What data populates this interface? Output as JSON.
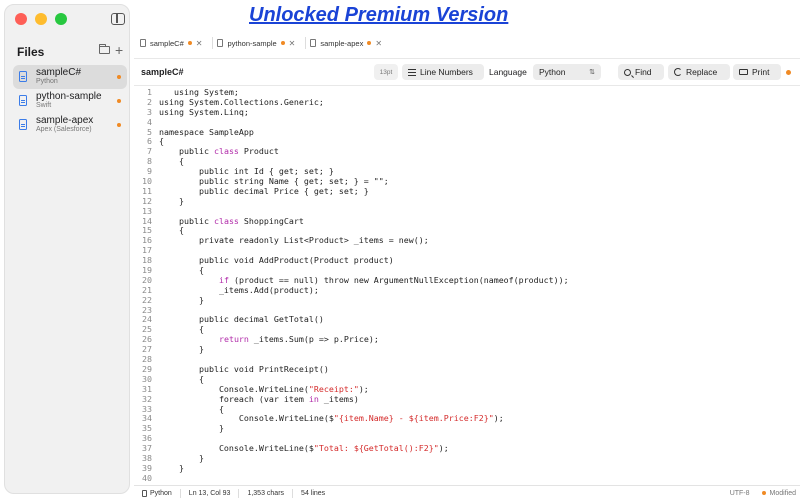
{
  "banner": "Unlocked Premium Version",
  "sidebar": {
    "title": "Files",
    "files": [
      {
        "name": "sampleC#",
        "language": "Python"
      },
      {
        "name": "python-sample",
        "language": "Swift"
      },
      {
        "name": "sample-apex",
        "language": "Apex (Salesforce)"
      }
    ]
  },
  "tabs": [
    "sampleC#",
    "python-sample",
    "sample-apex"
  ],
  "toolbar": {
    "file_title": "sampleC#",
    "font_size": "13pt",
    "line_numbers_label": "Line Numbers",
    "language_label": "Language",
    "language_value": "Python",
    "find_label": "Find",
    "replace_label": "Replace",
    "print_label": "Print"
  },
  "status": {
    "language": "Python",
    "position": "Ln 13, Col 93",
    "chars": "1,353 chars",
    "lines": "54 lines",
    "encoding": "UTF-8",
    "state": "Modified"
  },
  "colors": {
    "accent": "#3b7ce8",
    "modified_dot": "#f08a24",
    "keyword": "#b12ba9",
    "string": "#d42a2a",
    "banner": "#1a43d6"
  },
  "code_lines": [
    {
      "n": "1",
      "t": "   using System;"
    },
    {
      "n": "2",
      "t": "using System.Collections.Generic;"
    },
    {
      "n": "3",
      "t": "using System.Linq;"
    },
    {
      "n": "4",
      "t": ""
    },
    {
      "n": "5",
      "t": "namespace SampleApp"
    },
    {
      "n": "6",
      "t": "{"
    },
    {
      "n": "7",
      "t": "    public |class| Product"
    },
    {
      "n": "8",
      "t": "    {"
    },
    {
      "n": "9",
      "t": "        public int Id { get; set; }"
    },
    {
      "n": "10",
      "t": "        public string Name { get; set; } = \"\";"
    },
    {
      "n": "11",
      "t": "        public decimal Price { get; set; }"
    },
    {
      "n": "12",
      "t": "    }"
    },
    {
      "n": "13",
      "t": ""
    },
    {
      "n": "14",
      "t": "    public |class| ShoppingCart"
    },
    {
      "n": "15",
      "t": "    {"
    },
    {
      "n": "16",
      "t": "        private readonly List<Product> _items = new();"
    },
    {
      "n": "17",
      "t": ""
    },
    {
      "n": "18",
      "t": "        public void AddProduct(Product product)"
    },
    {
      "n": "19",
      "t": "        {"
    },
    {
      "n": "20",
      "t": "            |if| (product == null) throw new ArgumentNullException(nameof(product));"
    },
    {
      "n": "21",
      "t": "            _items.Add(product);"
    },
    {
      "n": "22",
      "t": "        }"
    },
    {
      "n": "23",
      "t": ""
    },
    {
      "n": "24",
      "t": "        public decimal GetTotal()"
    },
    {
      "n": "25",
      "t": "        {"
    },
    {
      "n": "26",
      "t": "            |return| _items.Sum(p => p.Price);"
    },
    {
      "n": "27",
      "t": "        }"
    },
    {
      "n": "28",
      "t": ""
    },
    {
      "n": "29",
      "t": "        public void PrintReceipt()"
    },
    {
      "n": "30",
      "t": "        {"
    },
    {
      "n": "31",
      "t": "            Console.WriteLine(~\"Receipt:\"~);"
    },
    {
      "n": "32",
      "t": "            foreach (var item |in| _items)"
    },
    {
      "n": "33",
      "t": "            {"
    },
    {
      "n": "34",
      "t": "                Console.WriteLine($~\"{item.Name} - ${item.Price:F2}\"~);"
    },
    {
      "n": "35",
      "t": "            }"
    },
    {
      "n": "36",
      "t": ""
    },
    {
      "n": "37",
      "t": "            Console.WriteLine($~\"Total: ${GetTotal():F2}\"~);"
    },
    {
      "n": "38",
      "t": "        }"
    },
    {
      "n": "39",
      "t": "    }"
    },
    {
      "n": "40",
      "t": ""
    }
  ]
}
